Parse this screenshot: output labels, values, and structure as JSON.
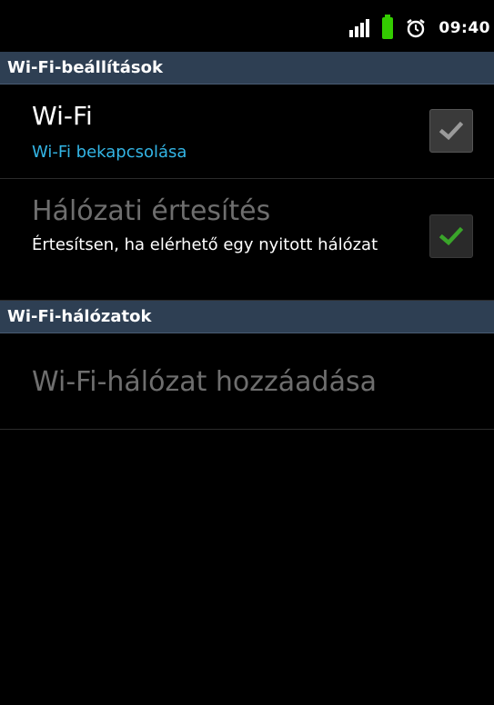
{
  "status_bar": {
    "time": "09:40",
    "signal_icon": "signal-bars-icon",
    "battery_icon": "battery-icon",
    "alarm_icon": "alarm-clock-icon",
    "battery_color": "#33cc00"
  },
  "sections": {
    "settings_header": "Wi-Fi-beállítások",
    "networks_header": "Wi-Fi-hálózatok"
  },
  "wifi": {
    "title": "Wi-Fi",
    "subtitle": "Wi-Fi bekapcsolása",
    "checked": true
  },
  "notification": {
    "title": "Hálózati értesítés",
    "subtitle": "Értesítsen, ha elérhető egy nyitott hálózat",
    "checked": true,
    "enabled": false
  },
  "add_network": {
    "title": "Wi-Fi-hálózat hozzáadása",
    "enabled": false
  },
  "colors": {
    "section_header_bg": "#2e3f53",
    "accent_blue": "#33b5e5",
    "check_green": "#3aa52a",
    "disabled_text": "#6e6e6e"
  }
}
